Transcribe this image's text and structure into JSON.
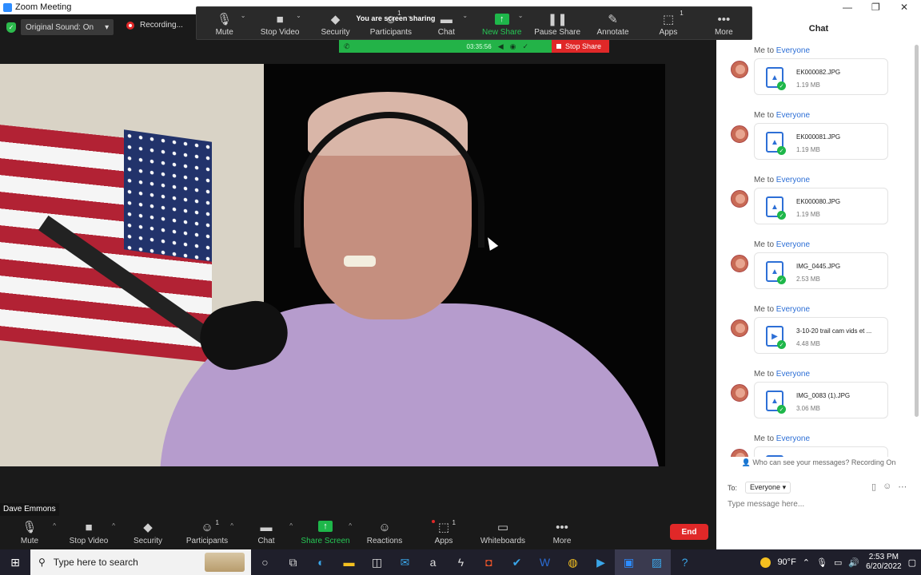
{
  "window": {
    "title": "Zoom Meeting"
  },
  "status": {
    "original_sound": "Original Sound: On",
    "recording": "Recording..."
  },
  "share_toolbar": {
    "items": [
      {
        "label": "Mute",
        "icon": "🎙"
      },
      {
        "label": "Stop Video",
        "icon": "■"
      },
      {
        "label": "Security",
        "icon": "◆"
      },
      {
        "label": "Participants",
        "icon": "☺",
        "count": "1"
      },
      {
        "label": "Chat",
        "icon": "▬"
      },
      {
        "label": "New Share",
        "icon": "↑"
      },
      {
        "label": "Pause Share",
        "icon": "❚❚"
      },
      {
        "label": "Annotate",
        "icon": "✎"
      },
      {
        "label": "Apps",
        "icon": "⬚",
        "count": "1"
      },
      {
        "label": "More",
        "icon": "•••"
      }
    ]
  },
  "share_banner": {
    "message": "You are screen sharing",
    "time": "03:35:56",
    "stop": "Stop Share"
  },
  "participant": {
    "name": "Dave Emmons"
  },
  "bottom_toolbar": {
    "items": [
      {
        "label": "Mute",
        "icon": "🎙"
      },
      {
        "label": "Stop Video",
        "icon": "■"
      },
      {
        "label": "Security",
        "icon": "◆"
      },
      {
        "label": "Participants",
        "icon": "☺",
        "count": "1"
      },
      {
        "label": "Chat",
        "icon": "▬"
      },
      {
        "label": "Share Screen",
        "icon": "↑"
      },
      {
        "label": "Reactions",
        "icon": "☺"
      },
      {
        "label": "Apps",
        "icon": "⬚",
        "count": "1"
      },
      {
        "label": "Whiteboards",
        "icon": "▭"
      },
      {
        "label": "More",
        "icon": "•••"
      }
    ],
    "end": "End"
  },
  "chat": {
    "title": "Chat",
    "messages": [
      {
        "from": "Me to",
        "to": "Everyone",
        "file": "EK000082.JPG",
        "size": "1.19 MB",
        "kind": "image"
      },
      {
        "from": "Me to",
        "to": "Everyone",
        "file": "EK000081.JPG",
        "size": "1.19 MB",
        "kind": "image"
      },
      {
        "from": "Me to",
        "to": "Everyone",
        "file": "EK000080.JPG",
        "size": "1.19 MB",
        "kind": "image"
      },
      {
        "from": "Me to",
        "to": "Everyone",
        "file": "IMG_0445.JPG",
        "size": "2.53 MB",
        "kind": "image"
      },
      {
        "from": "Me to",
        "to": "Everyone",
        "file": "3-10-20 trail cam vids et ...",
        "size": "4.48 MB",
        "kind": "video"
      },
      {
        "from": "Me to",
        "to": "Everyone",
        "file": "IMG_0083 (1).JPG",
        "size": "3.06 MB",
        "kind": "image"
      },
      {
        "from": "Me to",
        "to": "Everyone",
        "file": "",
        "size": "",
        "kind": "image"
      }
    ],
    "who_can_see": "Who can see your messages? Recording On",
    "to_label": "To:",
    "to_value": "Everyone",
    "input_placeholder": "Type message here..."
  },
  "taskbar": {
    "search_placeholder": "Type here to search",
    "weather": "90°F",
    "time": "2:53 PM",
    "date": "6/20/2022"
  },
  "colors": {
    "zoom_blue": "#2d8cff",
    "share_green": "#23b348",
    "stop_red": "#e02828",
    "link_blue": "#2d6fd6"
  }
}
